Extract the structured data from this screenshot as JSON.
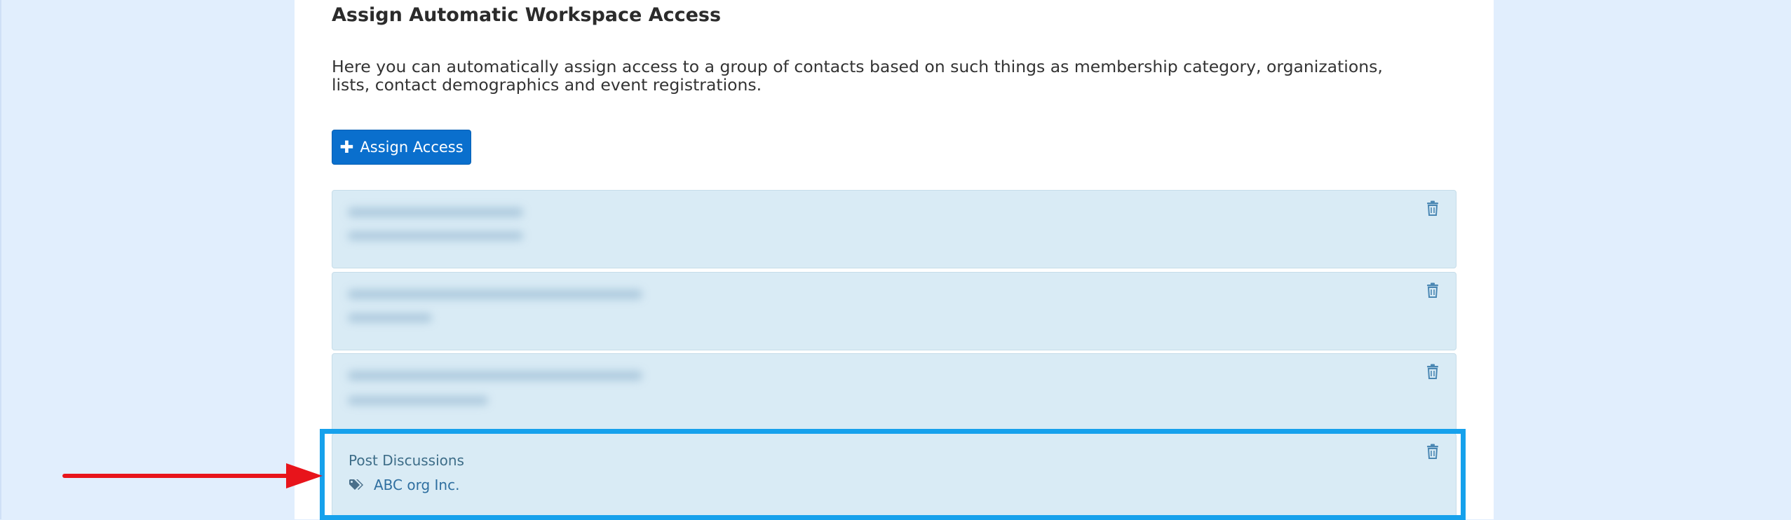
{
  "section": {
    "title": "Assign Automatic Workspace Access",
    "description": "Here you can automatically assign access to a group of contacts based on such things as membership category, organizations, lists, contact demographics and event registrations."
  },
  "assign_button": {
    "icon": "plus-icon",
    "label": "Assign Access"
  },
  "access_items": [
    {
      "title": "",
      "tag": "",
      "blurred": true
    },
    {
      "title": "",
      "tag": "",
      "blurred": true
    },
    {
      "title": "",
      "tag": "",
      "blurred": true
    },
    {
      "title": "Post Discussions",
      "tag_icon": "tags-icon",
      "tag": "ABC org Inc.",
      "blurred": false
    }
  ],
  "colors": {
    "accent": "#0a6fcd",
    "item_background": "#d9ebf5",
    "highlight": "#16a1ec",
    "arrow": "#e8141b",
    "page_background": "#e1eefd"
  }
}
